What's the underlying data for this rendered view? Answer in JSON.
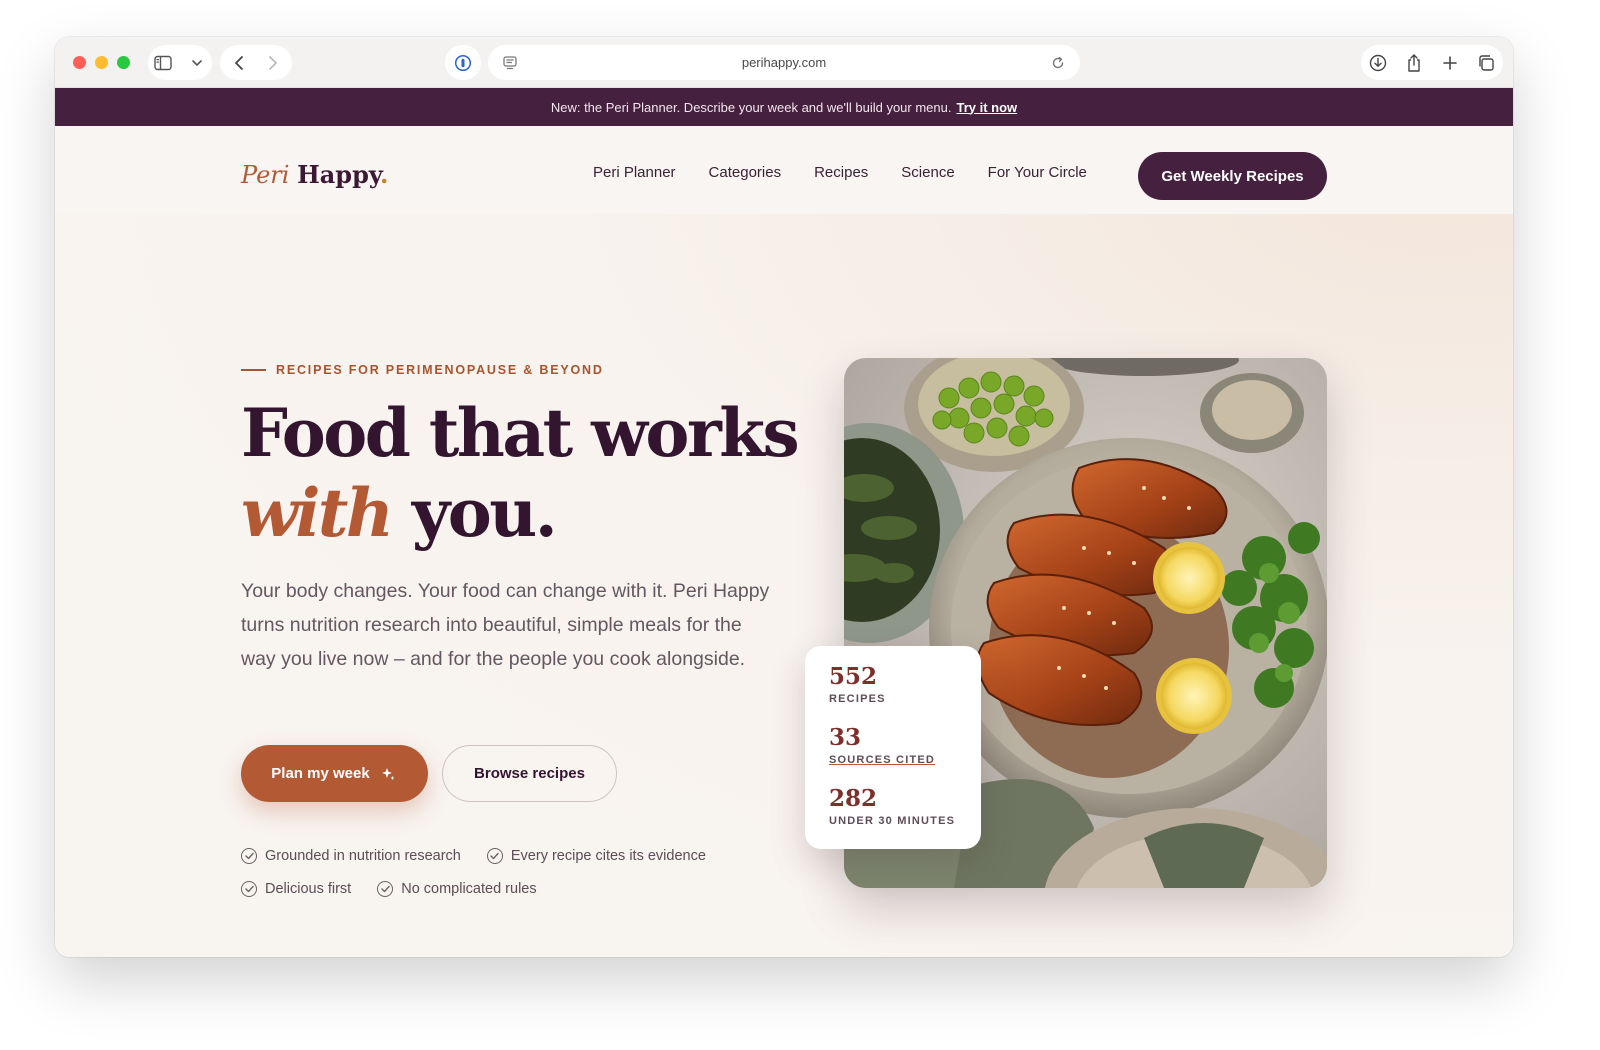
{
  "browser": {
    "url": "perihappy.com"
  },
  "announcement": {
    "text": "New: the Peri Planner. Describe your week and we'll build your menu.",
    "link": "Try it now"
  },
  "header": {
    "logo_peri": "Peri",
    "logo_happy": "Happy",
    "logo_dot": ".",
    "nav": [
      "Peri Planner",
      "Categories",
      "Recipes",
      "Science",
      "For Your Circle"
    ],
    "cta": "Get Weekly Recipes"
  },
  "hero": {
    "eyebrow": "RECIPES FOR PERIMENOPAUSE & BEYOND",
    "headline_line1": "Food that works",
    "headline_accent": "with",
    "headline_rest": "you.",
    "description": "Your body changes. Your food can change with it. Peri Happy turns nutrition research into beautiful, simple meals for the way you live now – and for the people you cook alongside.",
    "primary_button": "Plan my week",
    "secondary_button": "Browse recipes",
    "features": [
      "Grounded in nutrition research",
      "Every recipe cites its evidence",
      "Delicious first",
      "No complicated rules"
    ]
  },
  "stats": [
    {
      "value": "552",
      "label": "RECIPES"
    },
    {
      "value": "33",
      "label": "SOURCES CITED"
    },
    {
      "value": "282",
      "label": "UNDER 30 MINUTES"
    }
  ],
  "colors": {
    "brand_plum": "#46203f",
    "accent_terracotta": "#b35a35",
    "page_background": "#f8f3ef"
  },
  "icons": {
    "primary_button_icon": "sparkle-icon",
    "feature_icon": "check-circle-icon"
  }
}
